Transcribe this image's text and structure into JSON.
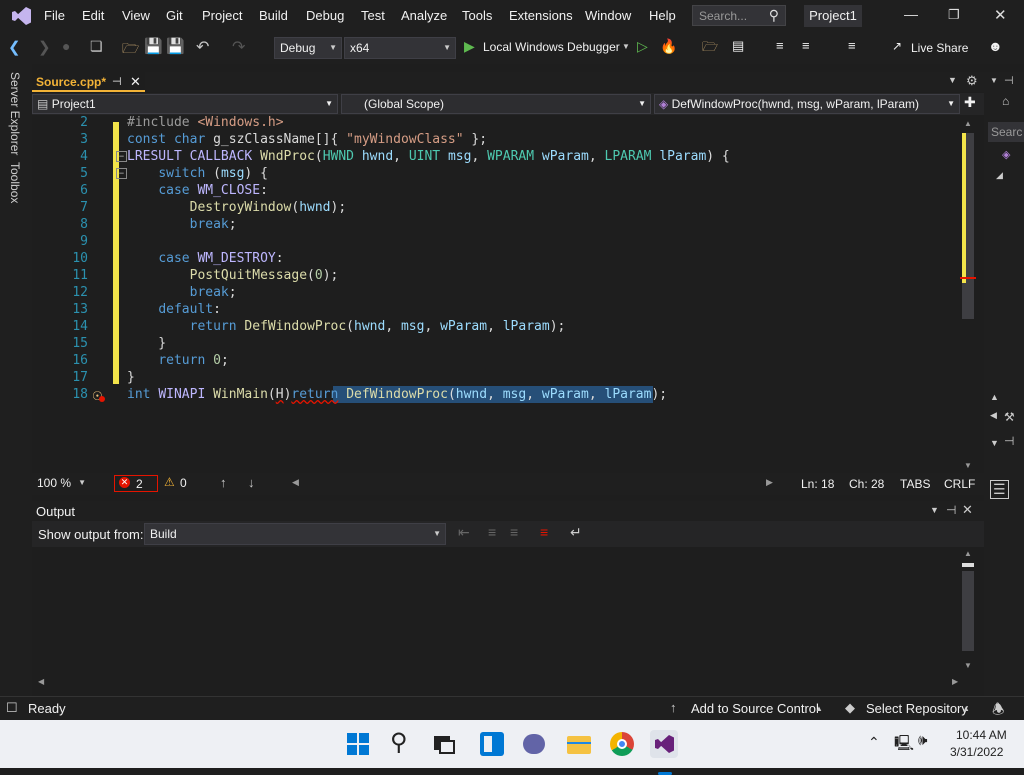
{
  "menu": [
    "File",
    "Edit",
    "View",
    "Git",
    "Project",
    "Build",
    "Debug",
    "Test",
    "Analyze",
    "Tools",
    "Extensions",
    "Window",
    "Help"
  ],
  "search_placeholder": "Search...",
  "project_name": "Project1",
  "toolbar": {
    "config": "Debug",
    "platform": "x64",
    "run_label": "Local Windows Debugger",
    "live_share": "Live Share"
  },
  "doc_tab": {
    "name": "Source.cpp*"
  },
  "navbar": {
    "project": "Project1",
    "scope": "(Global Scope)",
    "member": "DefWindowProc(hwnd, msg, wParam, lParam)"
  },
  "editor": {
    "line_numbers": [
      "2",
      "3",
      "4",
      "5",
      "6",
      "7",
      "8",
      "9",
      "10",
      "11",
      "12",
      "13",
      "14",
      "15",
      "16",
      "17",
      "18"
    ]
  },
  "edstatus": {
    "zoom": "100 %",
    "errors": "2",
    "warnings": "0",
    "line": "Ln: 18",
    "col": "Ch: 28",
    "tabs": "TABS",
    "eol": "CRLF"
  },
  "output": {
    "title": "Output",
    "show_from_label": "Show output from:",
    "source": "Build"
  },
  "left_rail": {
    "server_explorer": "Server Explorer",
    "toolbox": "Toolbox"
  },
  "right_rail": {
    "search": "Searc"
  },
  "status": {
    "ready": "Ready",
    "source_control": "Add to Source Control",
    "repo": "Select Repository"
  },
  "taskbar": {
    "time": "10:44 AM",
    "date": "3/31/2022"
  },
  "colors": {
    "accent": "#f3b337",
    "vs_purple": "#68217a",
    "keyword": "#569cd6"
  }
}
